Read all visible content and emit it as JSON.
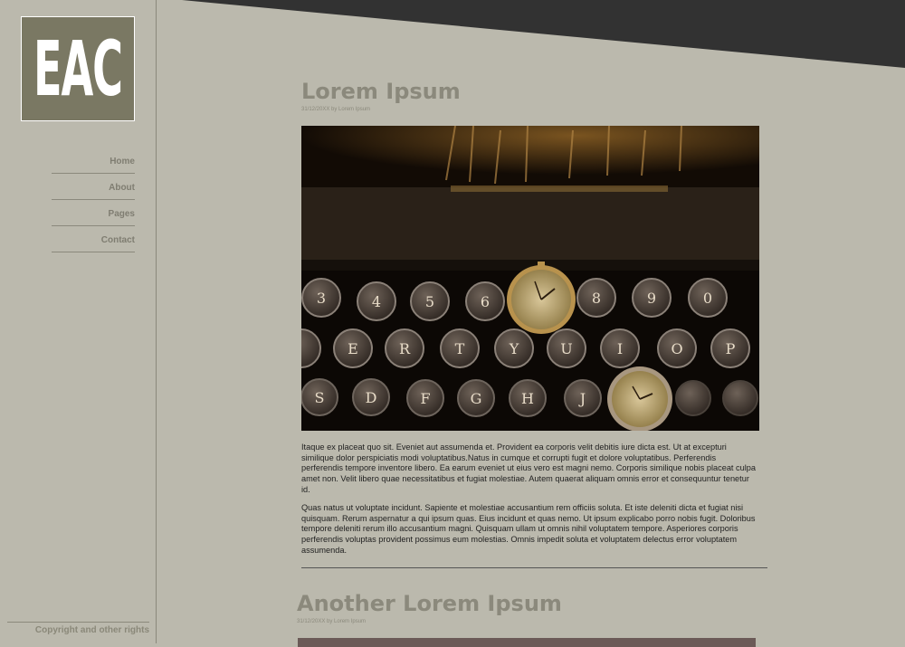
{
  "logo": {
    "text": "EAC"
  },
  "nav": {
    "items": [
      {
        "label": "Home"
      },
      {
        "label": "About"
      },
      {
        "label": "Pages"
      },
      {
        "label": "Contact"
      }
    ]
  },
  "sidebar": {
    "copyright": "Copyright and other rights"
  },
  "posts": [
    {
      "title": "Lorem Ipsum",
      "meta": "31/12/20XX by Lorem Ipsum",
      "image": "vintage-typewriter-with-pocket-watches",
      "paragraphs": [
        "Itaque ex placeat quo sit. Eveniet aut assumenda et. Provident ea corporis velit debitis iure dicta est. Ut at excepturi similique dolor perspiciatis modi voluptatibus.Natus in cumque et corrupti fugit et dolore voluptatibus. Perferendis perferendis tempore inventore libero. Ea earum eveniet ut eius vero est magni nemo. Corporis similique nobis placeat culpa amet non. Velit libero quae necessitatibus et fugiat molestiae. Autem quaerat aliquam omnis error et consequuntur tenetur id.",
        "Quas natus ut voluptate incidunt. Sapiente et molestiae accusantium rem officiis soluta. Et iste deleniti dicta et fugiat nisi quisquam. Rerum aspernatur a qui ipsum quas. Eius incidunt et quas nemo. Ut ipsum explicabo porro nobis fugit. Doloribus tempore deleniti rerum illo accusantium magni. Quisquam ullam ut omnis nihil voluptatem tempore. Asperiores corporis perferendis voluptas provident possimus eum molestias. Omnis impedit soluta et voluptatem delectus error voluptatem assumenda."
      ]
    },
    {
      "title": "Another Lorem Ipsum",
      "meta": "31/12/20XX by Lorem Ipsum"
    }
  ],
  "colors": {
    "background": "#bbb9ad",
    "banner": "#323232",
    "logo_bg": "#7a7863",
    "heading": "#8b897c",
    "nav_text": "#7f7d71"
  }
}
